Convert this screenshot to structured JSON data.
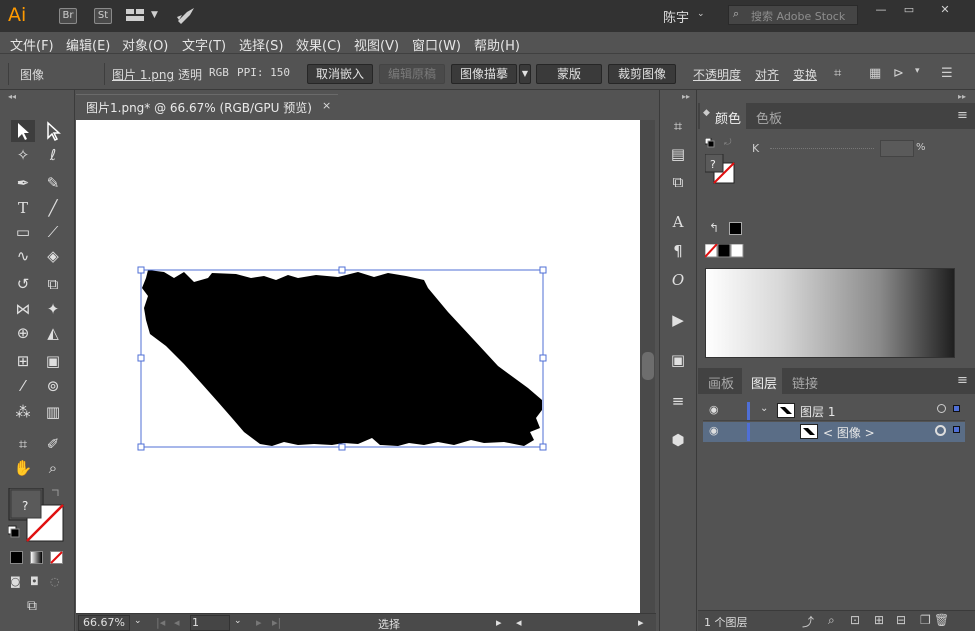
{
  "app": {
    "logo": "Ai",
    "top_icons": [
      "Br",
      "St"
    ],
    "user": "陈宇",
    "search_placeholder": "搜索 Adobe Stock"
  },
  "menu": [
    "文件(F)",
    "编辑(E)",
    "对象(O)",
    "文字(T)",
    "选择(S)",
    "效果(C)",
    "视图(V)",
    "窗口(W)",
    "帮助(H)"
  ],
  "control": {
    "label_image": "图像",
    "filename": "图片 1.png",
    "transparency": "透明",
    "colormode": "RGB",
    "ppi": "PPI: 150",
    "unembed": "取消嵌入",
    "edit_original": "编辑原稿",
    "image_trace": "图像描摹",
    "mask": "蒙版",
    "crop": "裁剪图像",
    "opacity": "不透明度",
    "align": "对齐",
    "transform": "变换"
  },
  "document": {
    "tab_title": "图片1.png* @ 66.67% (RGB/GPU 预览)",
    "close": "×"
  },
  "status": {
    "zoom": "66.67%",
    "artboard_num": "1",
    "tool_name": "选择"
  },
  "color_panel": {
    "tab_color": "颜色",
    "tab_swatches": "色板",
    "k_label": "K",
    "percent": "%",
    "question": "?"
  },
  "layers_panel": {
    "tab_artboards": "画板",
    "tab_layers": "图层",
    "tab_links": "链接",
    "layer1": "图层 1",
    "sublayer": "< 图像 >",
    "count": "1 个图层"
  },
  "colors": {
    "accent_selection": "#4f6fd6",
    "logo": "#ff9a00"
  }
}
